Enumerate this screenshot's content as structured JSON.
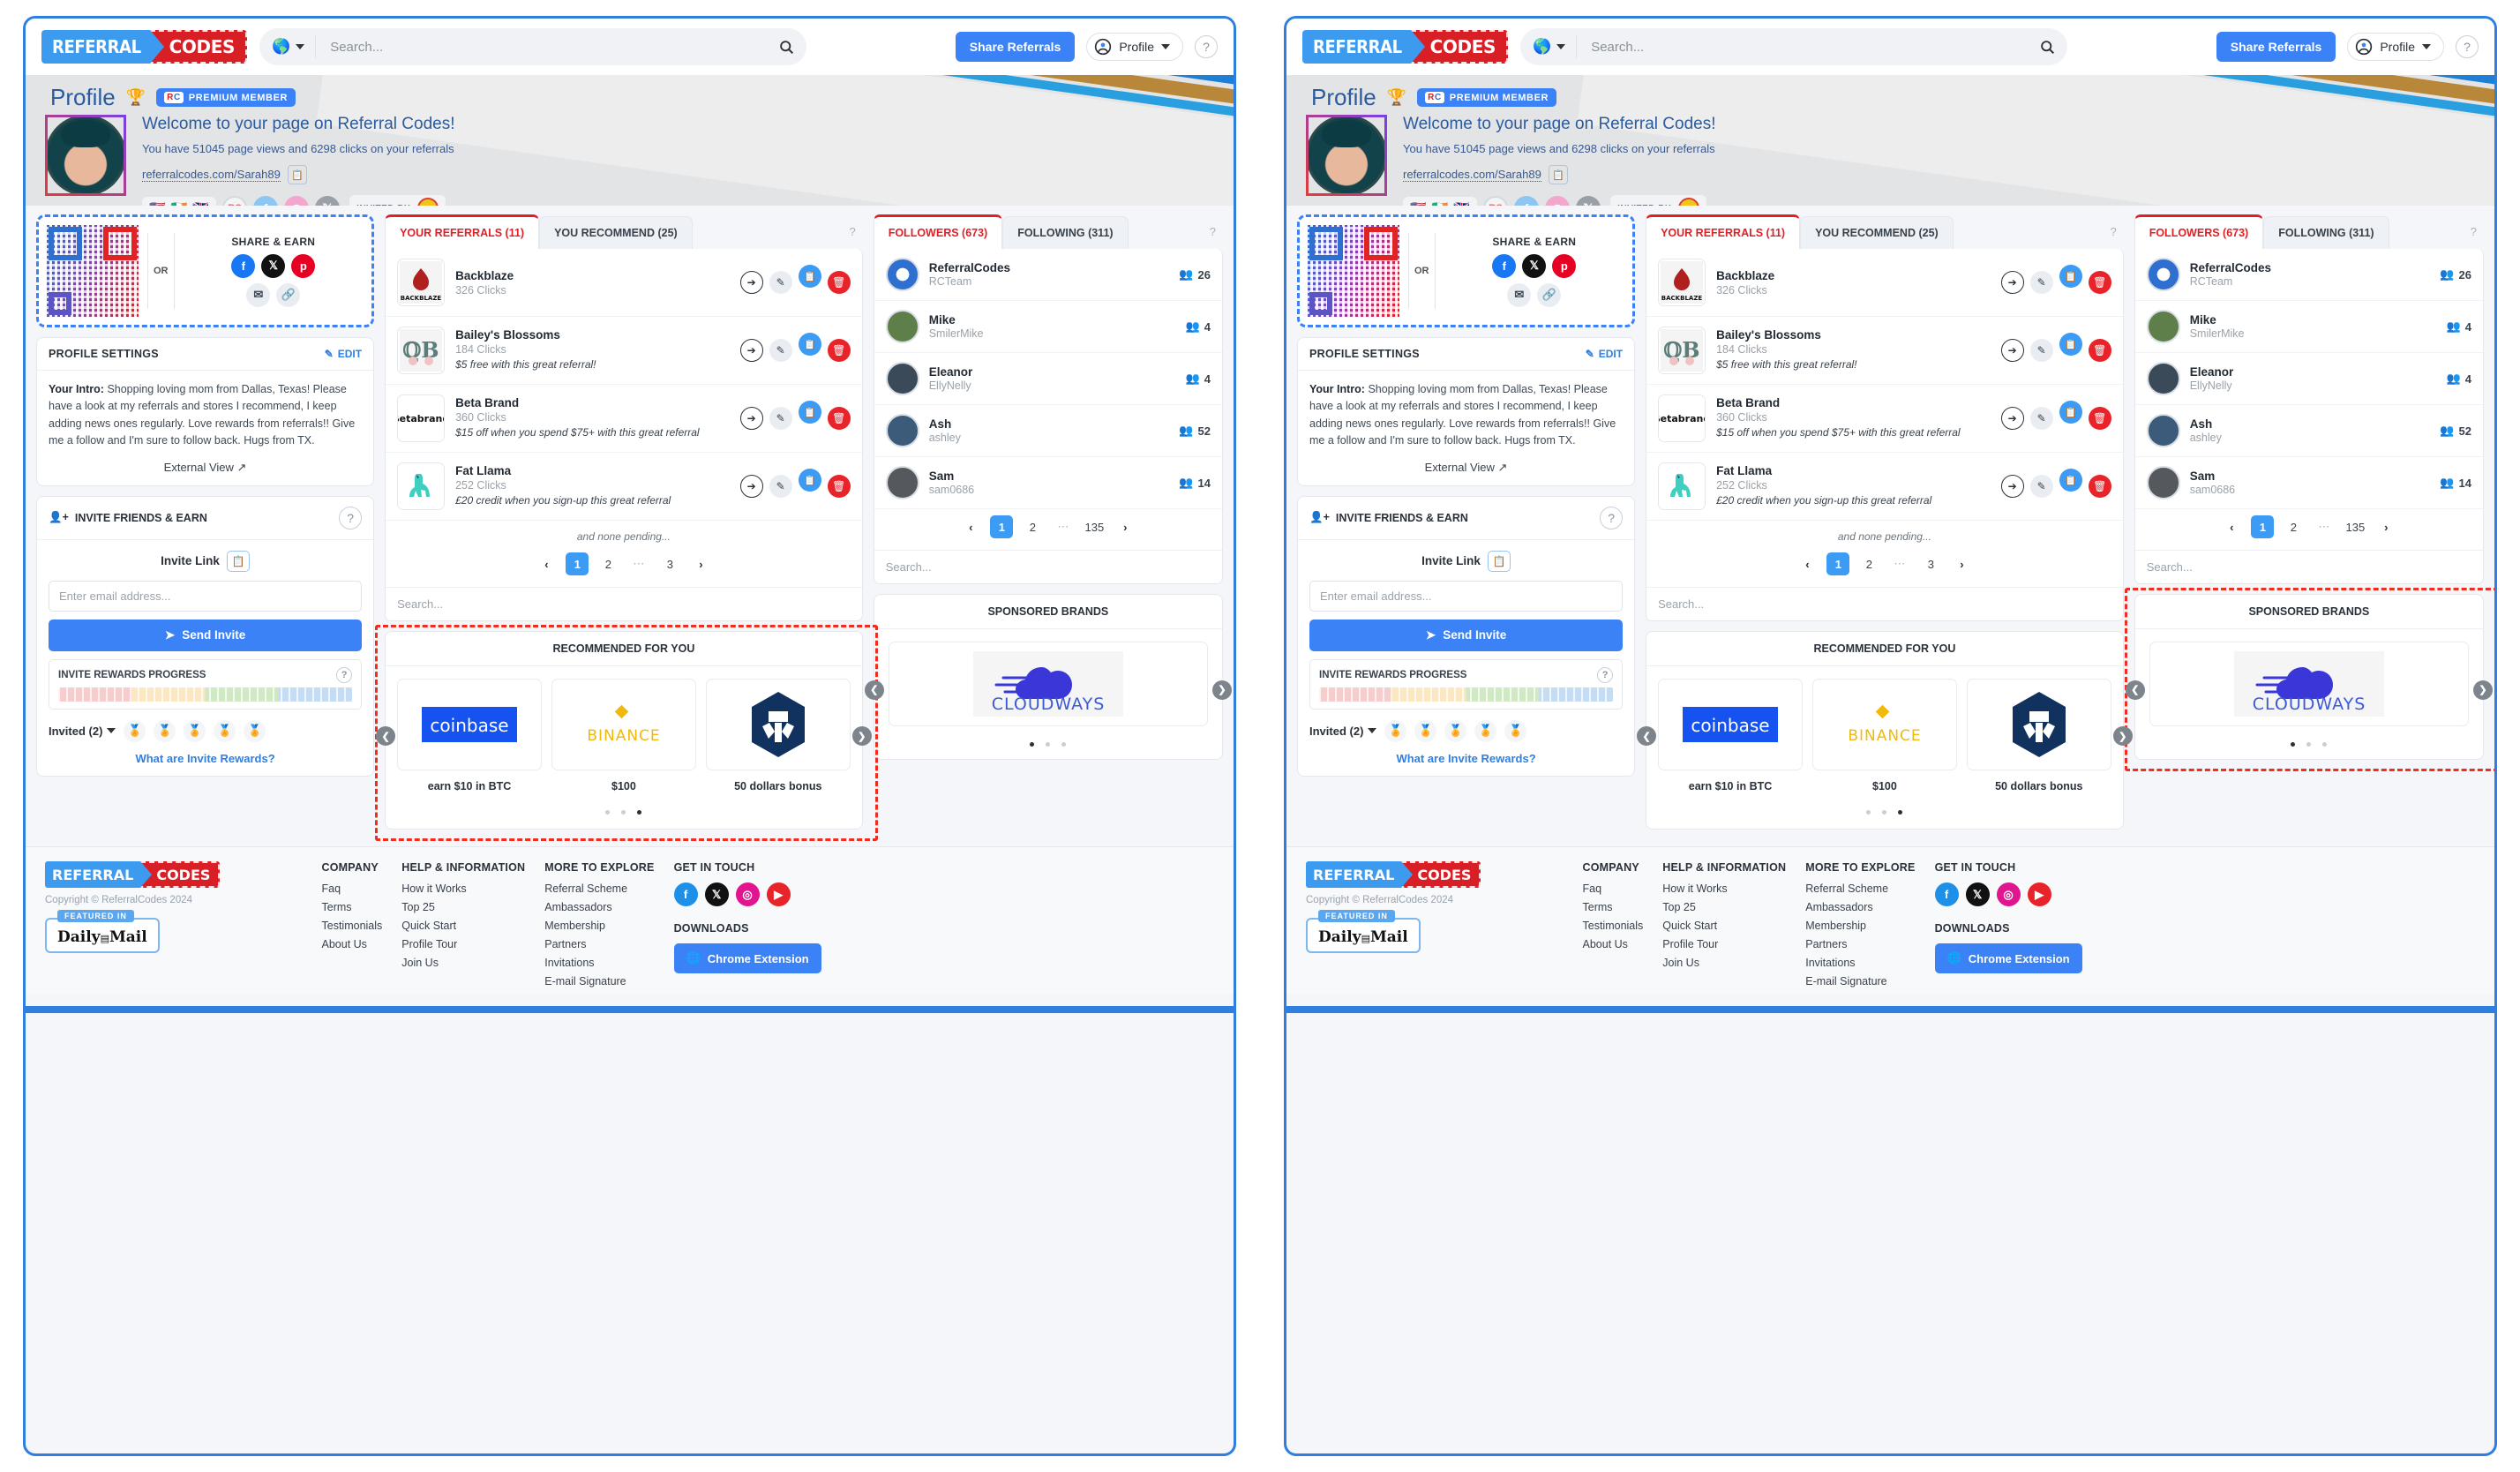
{
  "header": {
    "logo_left": "REFERRAL",
    "logo_right": "CODES",
    "search_placeholder": "Search...",
    "globe_icon": "globe-icon",
    "search_icon": "search-icon",
    "share_button": "Share Referrals",
    "profile_button": "Profile",
    "help_icon": "?"
  },
  "hero": {
    "title": "Profile",
    "trophy_icon": "trophy-icon",
    "premium_badge": "PREMIUM MEMBER",
    "rc_badge_r": "R",
    "rc_badge_c": "C",
    "welcome": "Welcome to your page on Referral Codes!",
    "stats": "You have 51045 page views and 6298 clicks on your referrals",
    "profile_url": "referralcodes.com/Sarah89",
    "copy_icon": "copy-icon",
    "flags": [
      "🇺🇸",
      "🇮🇪",
      "🇬🇧"
    ],
    "social": [
      "RC",
      "f",
      "◎",
      "𝕏"
    ],
    "invited_by_label": "INVITED BY"
  },
  "share_earn": {
    "or": "OR",
    "title": "SHARE & EARN",
    "icons": [
      "facebook-icon",
      "x-icon",
      "pinterest-icon",
      "email-icon",
      "link-icon"
    ],
    "fb": "f",
    "x": "𝕏",
    "pin": "p",
    "mail": "✉",
    "link": "🔗"
  },
  "profile_settings": {
    "title": "PROFILE SETTINGS",
    "edit": "EDIT",
    "edit_icon": "pencil-icon",
    "intro_label": "Your Intro:",
    "intro_text": "Shopping loving mom from Dallas, Texas! Please have a look at my referrals and stores I recommend, I keep adding news ones regularly. Love rewards from referrals!! Give me a follow and I'm sure to follow back. Hugs from TX.",
    "external_view": "External View",
    "external_icon": "external-link-icon"
  },
  "invite": {
    "title": "INVITE FRIENDS & EARN",
    "user_icon": "user-plus-icon",
    "help_icon": "?",
    "invite_link_label": "Invite Link",
    "copy_icon": "copy-icon",
    "email_placeholder": "Enter email address...",
    "send_button": "Send Invite",
    "send_icon": "paper-plane-icon",
    "progress_title": "INVITE REWARDS PROGRESS",
    "progress_help": "?",
    "invited_label": "Invited (2)",
    "medals": 5,
    "medal_icon": "medal-icon",
    "what_are_link": "What are Invite Rewards?"
  },
  "referrals_panel": {
    "tabs": [
      {
        "label": "YOUR REFERRALS (11)",
        "active": true
      },
      {
        "label": "YOU RECOMMEND (25)",
        "active": false
      }
    ],
    "help_icon": "?",
    "rows": [
      {
        "name": "Backblaze",
        "clicks": "326 Clicks",
        "offer": "",
        "logo": "backblaze-logo"
      },
      {
        "name": "Bailey's Blossoms",
        "clicks": "184 Clicks",
        "offer": "$5 free with this great referral!",
        "logo": "baileys-blossoms-logo"
      },
      {
        "name": "Beta Brand",
        "clicks": "360 Clicks",
        "offer": "$15 off when you spend $75+ with this great referral",
        "logo": "betabrand-logo"
      },
      {
        "name": "Fat Llama",
        "clicks": "252 Clicks",
        "offer": "£20 credit when you sign-up this great referral",
        "logo": "fat-llama-logo"
      }
    ],
    "action_icons": [
      "share-icon",
      "edit-icon",
      "copy-icon",
      "delete-icon"
    ],
    "pending_note": "and none pending...",
    "pagination": {
      "prev": "‹",
      "pages": [
        "1",
        "2",
        "⋯",
        "3"
      ],
      "active": "1",
      "next": "›"
    },
    "search_placeholder": "Search..."
  },
  "recommended": {
    "title": "RECOMMENDED FOR YOU",
    "items": [
      {
        "brand": "coinbase",
        "caption": "earn $10 in BTC"
      },
      {
        "brand": "BINANCE",
        "caption": "$100"
      },
      {
        "brand": "crypto.com",
        "caption": "50 dollars bonus"
      }
    ],
    "dots": 3,
    "active_dot": 2,
    "prev_icon": "chevron-left-icon",
    "next_icon": "chevron-right-icon"
  },
  "followers_panel": {
    "tabs": [
      {
        "label": "FOLLOWERS (673)",
        "active": true
      },
      {
        "label": "FOLLOWING (311)",
        "active": false
      }
    ],
    "help_icon": "?",
    "rows": [
      {
        "name": "ReferralCodes",
        "handle": "RCTeam",
        "count": "26"
      },
      {
        "name": "Mike",
        "handle": "SmilerMike",
        "count": "4"
      },
      {
        "name": "Eleanor",
        "handle": "EllyNelly",
        "count": "4"
      },
      {
        "name": "Ash",
        "handle": "ashley",
        "count": "52"
      },
      {
        "name": "Sam",
        "handle": "sam0686",
        "count": "14"
      }
    ],
    "followers_icon": "users-icon",
    "pagination": {
      "prev": "‹",
      "pages": [
        "1",
        "2",
        "⋯",
        "135"
      ],
      "active": "1",
      "next": "›"
    },
    "search_placeholder": "Search..."
  },
  "sponsored": {
    "title": "SPONSORED BRANDS",
    "brand": "CLOUDWAYS",
    "dots": 3,
    "active_dot": 0,
    "prev_icon": "chevron-left-icon",
    "next_icon": "chevron-right-icon"
  },
  "footer": {
    "logo_left": "REFERRAL",
    "logo_right": "CODES",
    "copyright": "Copyright © ReferralCodes 2024",
    "featured_tag": "FEATURED IN",
    "featured_name": "Daily",
    "featured_name2": "Mail",
    "columns": [
      {
        "title": "COMPANY",
        "links": [
          "Faq",
          "Terms",
          "Testimonials",
          "About Us"
        ]
      },
      {
        "title": "HELP & INFORMATION",
        "links": [
          "How it Works",
          "Top 25",
          "Quick Start",
          "Profile Tour",
          "Join Us"
        ]
      },
      {
        "title": "MORE TO EXPLORE",
        "links": [
          "Referral Scheme",
          "Ambassadors",
          "Membership",
          "Partners",
          "Invitations",
          "E-mail Signature"
        ]
      }
    ],
    "get_in_touch": "GET IN TOUCH",
    "socials": [
      "facebook-icon",
      "x-icon",
      "instagram-icon",
      "youtube-icon"
    ],
    "downloads": "DOWNLOADS",
    "chrome_button": "Chrome Extension",
    "chrome_icon": "chrome-icon"
  },
  "colors": {
    "brand_blue": "#3d9bef",
    "brand_red": "#d91f26",
    "accent": "#3b82f6",
    "highlight": "#f02d1f"
  }
}
